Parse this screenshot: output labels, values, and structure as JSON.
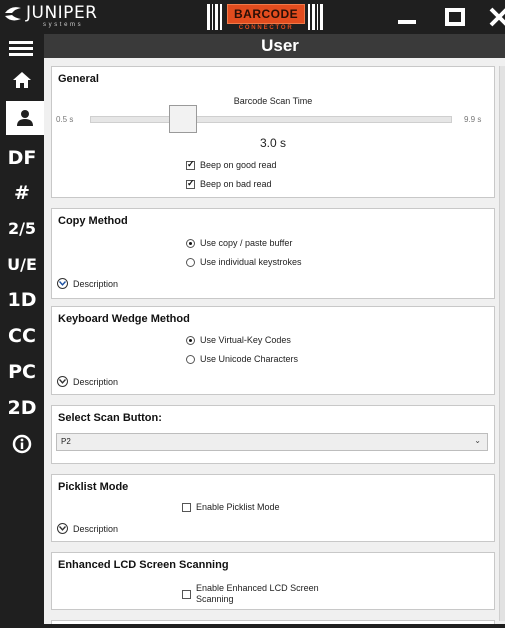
{
  "titlebar": {
    "brand_name": "JUNIPER",
    "brand_sub": "systems",
    "logo_main": "BARCODE",
    "logo_sub": "CONNECTOR"
  },
  "header": {
    "title": "User"
  },
  "sidebar": {
    "items": [
      {
        "label": "",
        "icon": "home-icon"
      },
      {
        "label": "",
        "icon": "user-icon"
      },
      {
        "label": "DF"
      },
      {
        "label": "#"
      },
      {
        "label": "2/5"
      },
      {
        "label": "U/E"
      },
      {
        "label": "1D"
      },
      {
        "label": "CC"
      },
      {
        "label": "PC"
      },
      {
        "label": "2D"
      },
      {
        "label": "",
        "icon": "info-icon"
      }
    ]
  },
  "general": {
    "title": "General",
    "slider_label": "Barcode Scan Time",
    "min_label": "0.5 s",
    "max_label": "9.9 s",
    "value_label": "3.0 s",
    "value": 3.0,
    "beep_good_label": "Beep on good read",
    "beep_good_checked": true,
    "beep_bad_label": "Beep on bad read",
    "beep_bad_checked": true
  },
  "copy_method": {
    "title": "Copy Method",
    "option1": "Use copy / paste buffer",
    "option2": "Use individual keystrokes",
    "selected": 1,
    "description": "Description"
  },
  "keyboard_wedge": {
    "title": "Keyboard Wedge Method",
    "option1": "Use Virtual-Key Codes",
    "option2": "Use Unicode Characters",
    "selected": 1,
    "description": "Description"
  },
  "scan_button": {
    "title": "Select Scan Button:",
    "value": "P2"
  },
  "picklist": {
    "title": "Picklist Mode",
    "checkbox_label": "Enable Picklist Mode",
    "checked": false,
    "description": "Description"
  },
  "lcd": {
    "title": "Enhanced LCD Screen Scanning",
    "checkbox_label_line1": "Enable Enhanced LCD Screen",
    "checkbox_label_line2": "Scanning",
    "checked": false
  },
  "colors": {
    "chrome": "#1f1f1f",
    "header": "#3a3a3a",
    "logo_accent": "#e24c1e",
    "content_bg": "#f0f0f0"
  }
}
